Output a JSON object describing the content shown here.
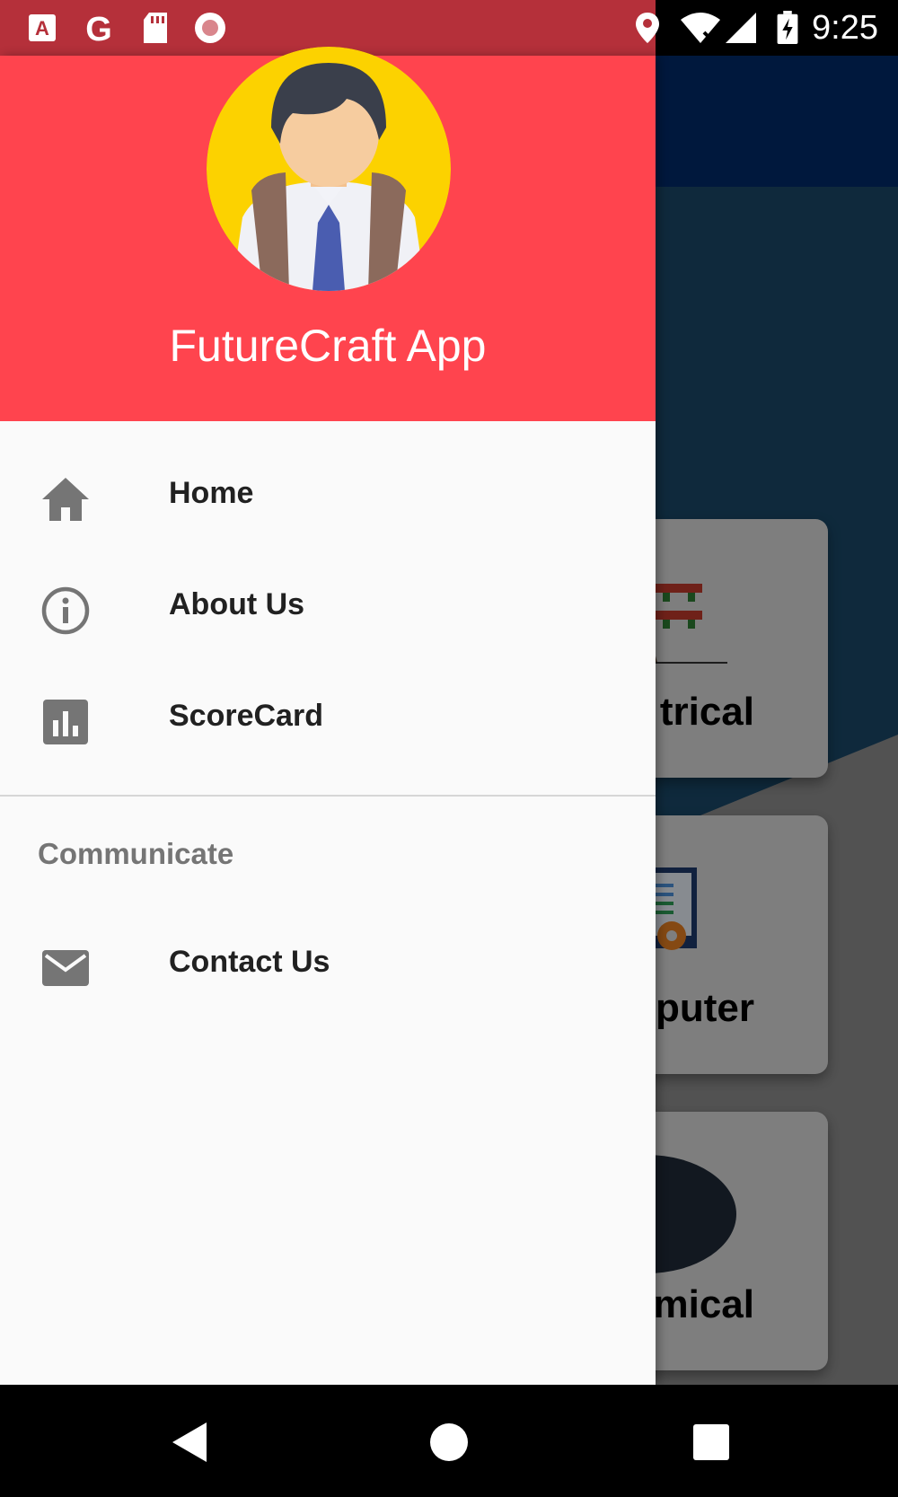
{
  "status_bar": {
    "time": "9:25",
    "left_icons": [
      "a-notification-icon",
      "google-icon",
      "sd-card-icon",
      "record-icon"
    ],
    "right_icons": [
      "location-icon",
      "wifi-icon",
      "cell-signal-icon",
      "battery-charging-icon"
    ]
  },
  "drawer": {
    "header": {
      "app_name": "FutureCraft App",
      "avatar": "student-avatar",
      "background": "#ff444e"
    },
    "menu": [
      {
        "label": "Home",
        "icon": "home-icon"
      },
      {
        "label": "About Us",
        "icon": "info-icon"
      },
      {
        "label": "ScoreCard",
        "icon": "bar-chart-icon"
      }
    ],
    "section": {
      "title": "Communicate",
      "items": [
        {
          "label": "Contact Us",
          "icon": "mail-icon"
        }
      ]
    }
  },
  "background_app": {
    "toolbar_color": "#012a6a",
    "cards": [
      {
        "label": "trical"
      },
      {
        "label": "puter"
      },
      {
        "label": "mical"
      }
    ]
  },
  "nav_bar": {
    "buttons": [
      "back-button",
      "home-button",
      "recents-button"
    ]
  }
}
